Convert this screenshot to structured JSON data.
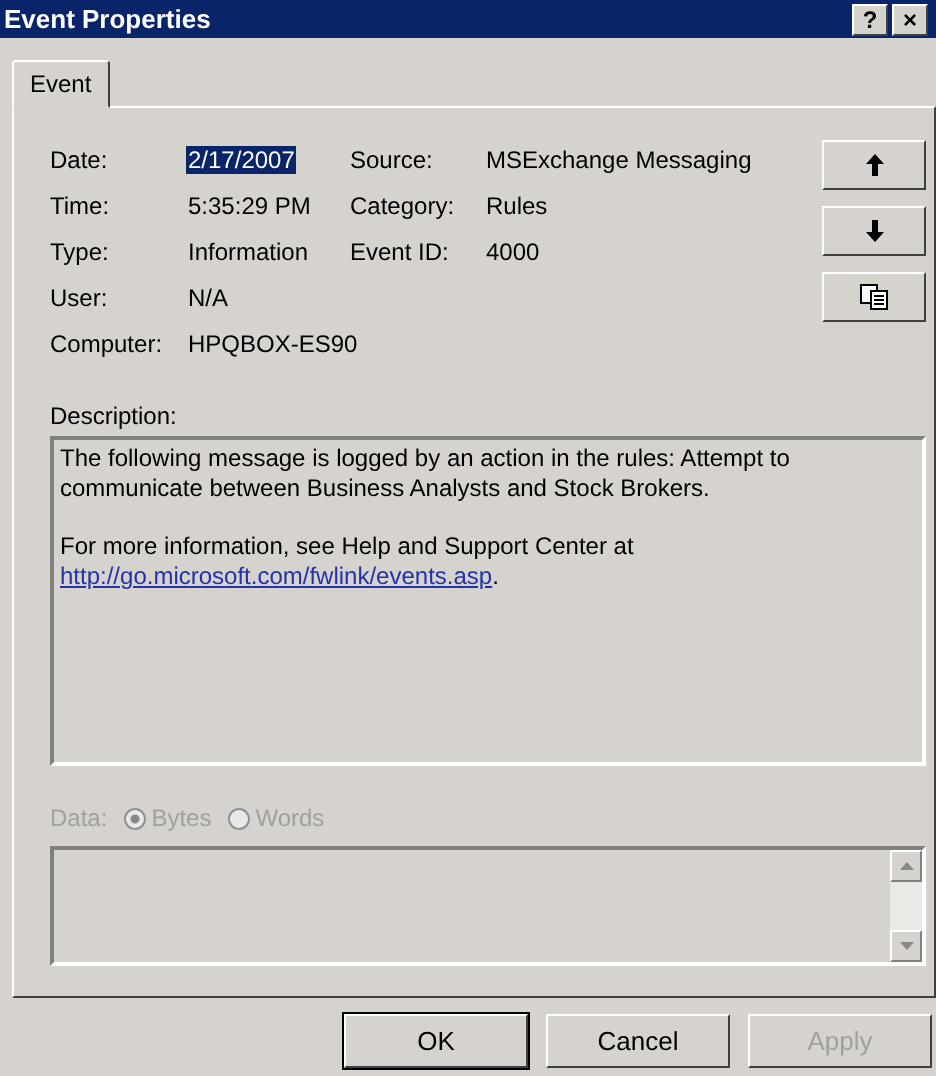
{
  "window": {
    "title": "Event Properties",
    "title_buttons": [
      "?",
      "×"
    ]
  },
  "tabs": [
    {
      "label": "Event",
      "selected": true
    }
  ],
  "fields": [
    [
      {
        "label": "Date:",
        "value": "2/17/2007",
        "selected": true
      },
      {
        "label": "Source:",
        "value": "MSExchange Messaging",
        "selected": false
      }
    ],
    [
      {
        "label": "Time:",
        "value": "5:35:29 PM",
        "selected": false
      },
      {
        "label": "Category:",
        "value": "Rules",
        "selected": false
      }
    ],
    [
      {
        "label": "Type:",
        "value": "Information",
        "selected": false
      },
      {
        "label": "Event ID:",
        "value": "4000",
        "selected": false
      }
    ],
    [
      {
        "label": "User:",
        "value": "N/A",
        "selected": false
      }
    ],
    [
      {
        "label": "Computer:",
        "value": "HPQBOX-ES90",
        "selected": false
      }
    ]
  ],
  "side_buttons": [
    {
      "kind": "up"
    },
    {
      "kind": "down"
    },
    {
      "kind": "copy"
    }
  ],
  "description": {
    "label": "Description:",
    "paragraphs": [
      {
        "text": "The following message is logged by an action in the rules: Attempt to communicate between Business Analysts and Stock Brokers."
      },
      {
        "text": "For more information, see Help and Support Center at",
        "link": "http://go.microsoft.com/fwlink/events.asp",
        "after": "."
      }
    ]
  },
  "data": {
    "label": "Data:",
    "disabled": true,
    "options": [
      {
        "label": "Bytes",
        "selected": true
      },
      {
        "label": "Words",
        "selected": false
      }
    ]
  },
  "buttons": [
    {
      "label": "OK",
      "default": true,
      "disabled": false
    },
    {
      "label": "Cancel",
      "default": false,
      "disabled": false
    },
    {
      "label": "Apply",
      "default": false,
      "disabled": true
    }
  ]
}
